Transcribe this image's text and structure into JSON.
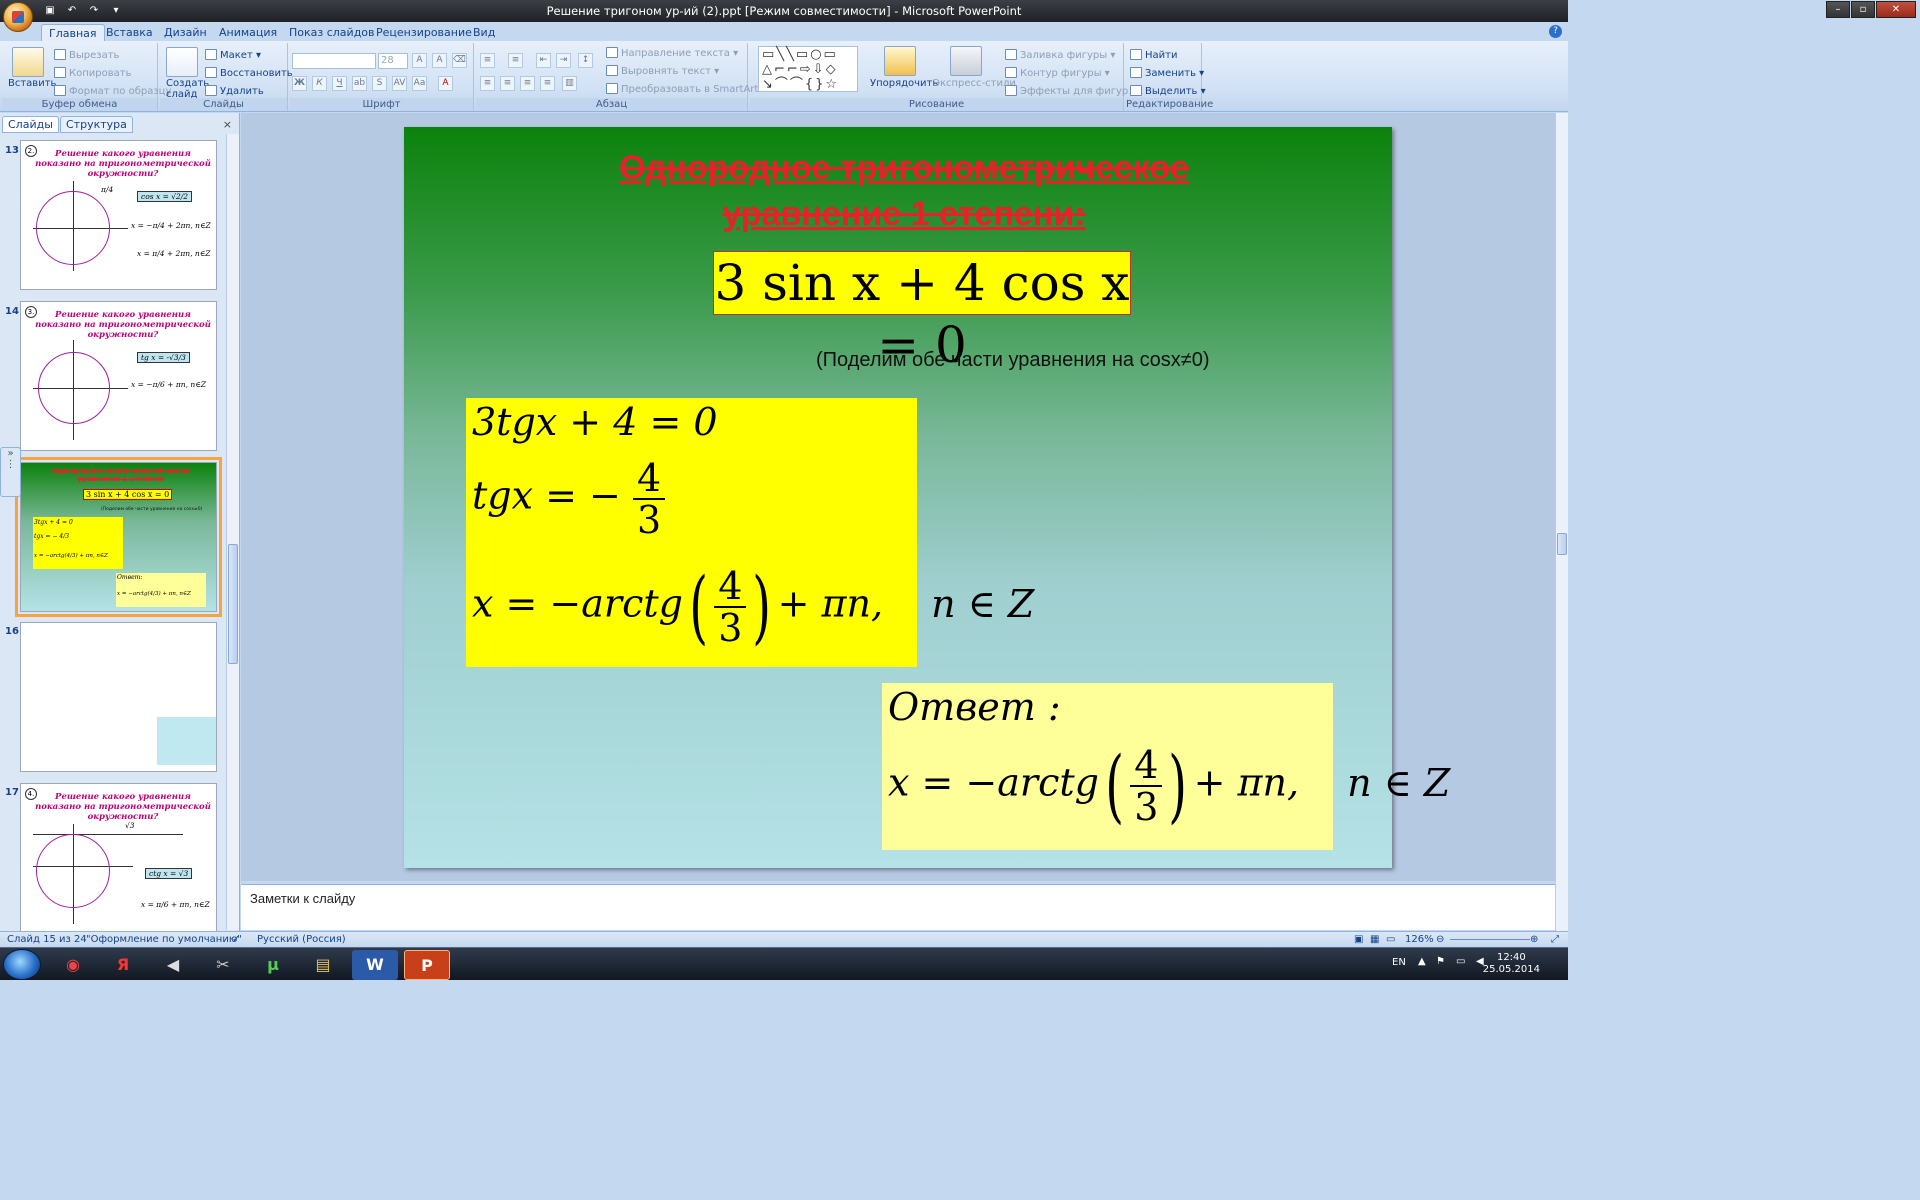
{
  "window": {
    "title": "Решение тригоном ур-ий (2).ppt [Режим совместимости] - Microsoft PowerPoint"
  },
  "tabs": [
    "Главная",
    "Вставка",
    "Дизайн",
    "Анимация",
    "Показ слайдов",
    "Рецензирование",
    "Вид"
  ],
  "ribbon": {
    "clipboard": {
      "label": "Буфер обмена",
      "paste": "Вставить",
      "cut": "Вырезать",
      "copy": "Копировать",
      "format": "Формат по образцу"
    },
    "slides": {
      "label": "Слайды",
      "create": "Создать",
      "create2": "слайд",
      "layout": "Макет",
      "reset": "Восстановить",
      "delete": "Удалить"
    },
    "font": {
      "label": "Шрифт",
      "size": "28"
    },
    "paragraph": {
      "label": "Абзац",
      "direction": "Направление текста",
      "align": "Выровнять текст",
      "smartart": "Преобразовать в SmartArt"
    },
    "drawing": {
      "label": "Рисование",
      "arrange": "Упорядочить",
      "styles": "Экспресс-стили",
      "fill": "Заливка фигуры",
      "outline": "Контур фигуры",
      "effects": "Эффекты для фигур"
    },
    "editing": {
      "label": "Редактирование",
      "find": "Найти",
      "replace": "Заменить",
      "select": "Выделить"
    }
  },
  "panel": {
    "tab_slides": "Слайды",
    "tab_outline": "Структура",
    "close": "×"
  },
  "thumbs": {
    "n13": "13",
    "n14": "14",
    "n15": "15",
    "n16": "16",
    "n17": "17",
    "title": "Решение какого уравнения показано на тригонометрической окружности?",
    "t13_box": "cos x = √2/2",
    "t13_f1": "x = −π/4 + 2πn, n∈Z",
    "t13_f2": "x = π/4 + 2πn, n∈Z",
    "t13_pi": "π/4",
    "t13_mark": "2.",
    "t14_box": "tg x = -√3/3",
    "t14_f1": "x = −π/6 + πn,  n∈Z",
    "t14_mark": "3.",
    "t15_title": "Однородное тригонометрическое уравнение 1 степени:",
    "t15_eq": "3 sin x + 4 cos x = 0",
    "t15_note": "(Поделим обе части уравнения на cosx≠0)",
    "t15_l1": "3tgx + 4 = 0",
    "t15_l2": "tgx = − 4/3",
    "t15_l3": "x = −arctg(4/3) + πn,  n∈Z",
    "t15_ans": "Ответ:",
    "t15_ans2": "x = −arctg(4/3) + πn,  n∈Z",
    "t17_box": "ctg x = √3",
    "t17_f1": "x = π/6 + πn,  n∈Z",
    "t17_mark": "4.",
    "t17_root": "√3"
  },
  "slide": {
    "title1": "Однородное тригонометрическое",
    "title2": "уравнение 1 степени:",
    "eq": "3 sin x + 4 cos x = 0",
    "note": "(Поделим обе части уравнения на cosx≠0)",
    "line1": "3tgx + 4 = 0",
    "line2a": "tgx = −",
    "num": "4",
    "den": "3",
    "line3a": "x = −arctg",
    "line3b": "+ πn,",
    "line3c": "n ∈ Z",
    "answer": "Ответ :",
    "ans_a": "x = −arctg",
    "ans_b": "+ πn,",
    "ans_c": "n ∈ Z",
    "paren_l": "(",
    "paren_r": ")"
  },
  "notes": {
    "placeholder": "Заметки к слайду"
  },
  "status": {
    "slide": "Слайд 15 из 24",
    "theme": "\"Оформление по умолчанию\"",
    "lang": "Русский (Россия)",
    "zoom": "126%"
  },
  "taskbar": {
    "lang": "EN",
    "time": "12:40",
    "date": "25.05.2014"
  }
}
